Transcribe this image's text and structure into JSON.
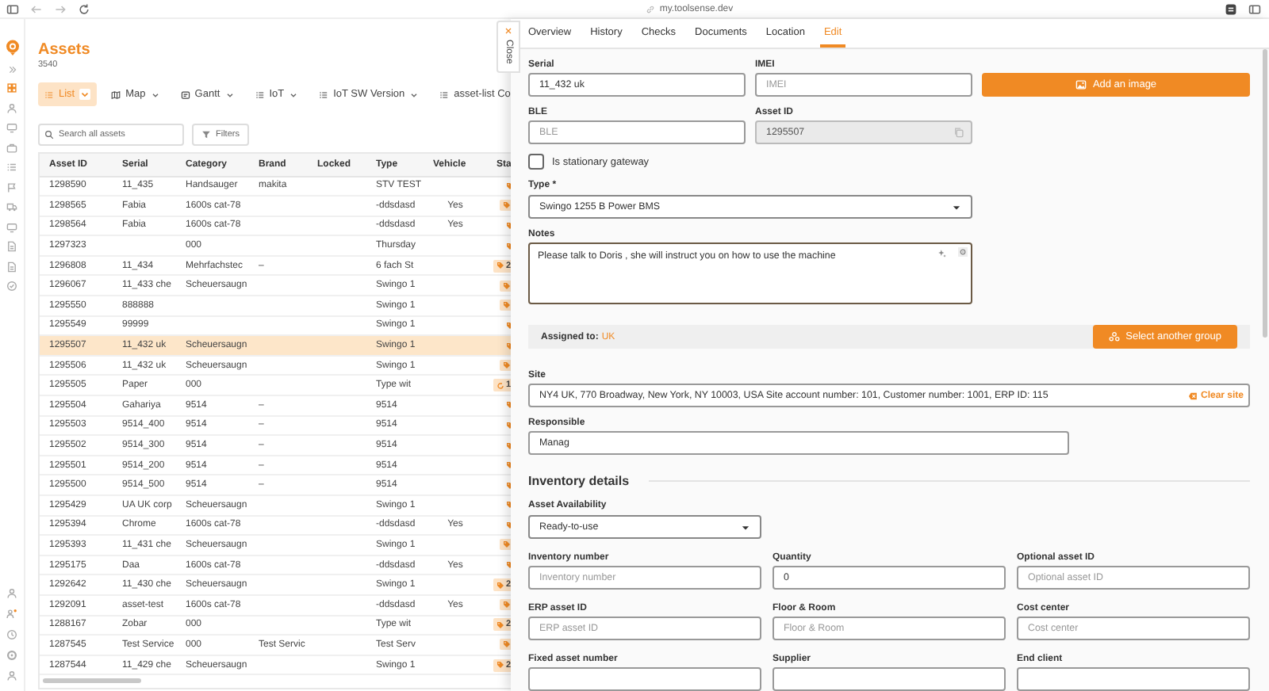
{
  "browser": {
    "url": "my.toolsense.dev"
  },
  "nav_items": [
    {
      "selected": true
    },
    {
      "selected": false
    },
    {
      "selected": false
    },
    {
      "selected": false
    },
    {
      "selected": false
    },
    {
      "selected": false
    },
    {
      "selected": false
    },
    {
      "selected": false
    },
    {
      "selected": false
    },
    {
      "selected": false
    },
    {
      "selected": false
    }
  ],
  "assets": {
    "title": "Assets",
    "count": "3540",
    "views": [
      {
        "label": "List",
        "kind": "list",
        "selected": true
      },
      {
        "label": "Map",
        "kind": "map",
        "selected": false
      },
      {
        "label": "Gantt",
        "kind": "gantt",
        "selected": false
      },
      {
        "label": "IoT",
        "kind": "list",
        "selected": false
      },
      {
        "label": "IoT SW Version",
        "kind": "list",
        "selected": false
      },
      {
        "label": "asset-list Co",
        "kind": "list",
        "selected": false
      }
    ],
    "search": {
      "placeholder": "Search all assets"
    },
    "filters_button": "Filters",
    "table": {
      "columns": [
        {
          "label": "Asset ID"
        },
        {
          "label": "Serial"
        },
        {
          "label": "Category"
        },
        {
          "label": "Brand"
        },
        {
          "label": "Locked"
        },
        {
          "label": "Type"
        },
        {
          "label": "Vehicle"
        },
        {
          "label": "Sta"
        }
      ],
      "rows": [
        {
          "asset_id": "1298590",
          "serial": "11_435",
          "category": "Handsauger",
          "brand": "makita",
          "type": "STV TEST",
          "status": {
            "kind": "plain"
          },
          "selected": false
        },
        {
          "asset_id": "1298565",
          "serial": "Fabia",
          "category": "1600s cat-78",
          "type": "-ddsdasd",
          "vehicle": "Yes",
          "status": {
            "kind": "badge"
          },
          "selected": false
        },
        {
          "asset_id": "1298564",
          "serial": "Fabia",
          "category": "1600s cat-78",
          "type": "-ddsdasd",
          "vehicle": "Yes",
          "status": {
            "kind": "plain"
          },
          "selected": false
        },
        {
          "asset_id": "1297323",
          "category": "000",
          "type": "Thursday",
          "status": {
            "kind": "plain"
          },
          "selected": false
        },
        {
          "asset_id": "1296808",
          "serial": "11_434",
          "category": "Mehrfachstec",
          "brand": "–",
          "type": "6 fach St",
          "status": {
            "kind": "count",
            "count": "2"
          },
          "selected": false
        },
        {
          "asset_id": "1296067",
          "serial": "11_433 che",
          "category": "Scheuersaugn",
          "type": "Swingo 1",
          "status": {
            "kind": "badge"
          },
          "selected": false
        },
        {
          "asset_id": "1295550",
          "serial": "888888",
          "type": "Swingo 1",
          "status": {
            "kind": "badge"
          },
          "selected": false
        },
        {
          "asset_id": "1295549",
          "serial": "99999",
          "type": "Swingo 1",
          "status": {
            "kind": "plain"
          },
          "selected": false
        },
        {
          "asset_id": "1295507",
          "serial": "11_432 uk",
          "category": "Scheuersaugn",
          "type": "Swingo 1",
          "status": {
            "kind": "plain"
          },
          "selected": true
        },
        {
          "asset_id": "1295506",
          "serial": "11_432 uk",
          "category": "Scheuersaugn",
          "type": "Swingo 1",
          "status": {
            "kind": "badge"
          },
          "selected": false
        },
        {
          "asset_id": "1295505",
          "serial": "Paper",
          "category": "000",
          "type": "Type wit",
          "status": {
            "kind": "iot",
            "count": "1"
          },
          "selected": false
        },
        {
          "asset_id": "1295504",
          "serial": "Gahariya",
          "category": "9514",
          "brand": "–",
          "type": "9514",
          "status": {
            "kind": "plain"
          },
          "selected": false
        },
        {
          "asset_id": "1295503",
          "serial": "9514_400",
          "category": "9514",
          "brand": "–",
          "type": "9514",
          "status": {
            "kind": "plain"
          },
          "selected": false
        },
        {
          "asset_id": "1295502",
          "serial": "9514_300",
          "category": "9514",
          "brand": "–",
          "type": "9514",
          "status": {
            "kind": "plain"
          },
          "selected": false
        },
        {
          "asset_id": "1295501",
          "serial": "9514_200",
          "category": "9514",
          "brand": "–",
          "type": "9514",
          "status": {
            "kind": "plain"
          },
          "selected": false
        },
        {
          "asset_id": "1295500",
          "serial": "9514_500",
          "category": "9514",
          "brand": "–",
          "type": "9514",
          "status": {
            "kind": "plain"
          },
          "selected": false
        },
        {
          "asset_id": "1295429",
          "serial": "UA UK corp",
          "category": "Scheuersaugn",
          "type": "Swingo 1",
          "status": {
            "kind": "plain"
          },
          "selected": false
        },
        {
          "asset_id": "1295394",
          "serial": "Chrome",
          "category": "1600s cat-78",
          "type": "-ddsdasd",
          "vehicle": "Yes",
          "status": {
            "kind": "plain"
          },
          "selected": false
        },
        {
          "asset_id": "1295393",
          "serial": "11_431 che",
          "category": "Scheuersaugn",
          "type": "Swingo 1",
          "status": {
            "kind": "badge"
          },
          "selected": false
        },
        {
          "asset_id": "1295175",
          "serial": "Daa",
          "category": "1600s cat-78",
          "type": "-ddsdasd",
          "vehicle": "Yes",
          "status": {
            "kind": "plain"
          },
          "selected": false
        },
        {
          "asset_id": "1292642",
          "serial": "11_430 che",
          "category": "Scheuersaugn",
          "type": "Swingo 1",
          "status": {
            "kind": "count",
            "count": "2"
          },
          "selected": false
        },
        {
          "asset_id": "1292091",
          "serial": "asset-test",
          "category": "1600s cat-78",
          "type": "-ddsdasd",
          "vehicle": "Yes",
          "status": {
            "kind": "badge"
          },
          "selected": false
        },
        {
          "asset_id": "1288167",
          "serial": "Zobar",
          "category": "000",
          "type": "Type wit",
          "status": {
            "kind": "count",
            "count": "2"
          },
          "selected": false
        },
        {
          "asset_id": "1287545",
          "serial": "Test Service",
          "category": "000",
          "brand": "Test Servic",
          "type": "Test Serv",
          "status": {
            "kind": "badge"
          },
          "selected": false
        },
        {
          "asset_id": "1287544",
          "serial": "11_429 che",
          "category": "Scheuersaugn",
          "type": "Swingo 1",
          "status": {
            "kind": "count",
            "count": "2"
          },
          "selected": false
        }
      ]
    }
  },
  "drawer": {
    "close_label": "Close",
    "tabs": [
      {
        "label": "Overview",
        "selected": false
      },
      {
        "label": "History",
        "selected": false
      },
      {
        "label": "Checks",
        "selected": false
      },
      {
        "label": "Documents",
        "selected": false
      },
      {
        "label": "Location",
        "selected": false
      },
      {
        "label": "Edit",
        "selected": true
      }
    ],
    "serial": {
      "label": "Serial",
      "value": "11_432 uk"
    },
    "imei": {
      "label": "IMEI",
      "placeholder": "IMEI"
    },
    "add_image_button": "Add an image",
    "ble": {
      "label": "BLE",
      "placeholder": "BLE"
    },
    "asset_id": {
      "label": "Asset ID",
      "value": "1295507",
      "disabled": true
    },
    "stationary_gateway": {
      "label": "Is stationary gateway",
      "checked": false
    },
    "type": {
      "label": "Type *",
      "value": "Swingo 1255 B Power BMS"
    },
    "notes": {
      "label": "Notes",
      "value": "Please talk to Doris , she will instruct you on how to use the machine"
    },
    "assigned": {
      "label": "Assigned to:",
      "group": "UK",
      "button": "Select another group"
    },
    "site": {
      "label": "Site",
      "value": "NY4 UK, 770 Broadway, New York, NY 10003, USA Site account number: 101, Customer number: 1001, ERP ID: 115",
      "clear_label": "Clear site"
    },
    "responsible": {
      "label": "Responsible",
      "value": "Manag"
    },
    "inventory": {
      "heading": "Inventory details",
      "availability": {
        "label": "Asset Availability",
        "value": "Ready-to-use"
      },
      "fields": [
        {
          "label": "Inventory number",
          "placeholder": "Inventory number"
        },
        {
          "label": "Quantity",
          "value": "0"
        },
        {
          "label": "Optional asset ID",
          "placeholder": "Optional asset ID"
        },
        {
          "label": "ERP asset ID",
          "placeholder": "ERP asset ID"
        },
        {
          "label": "Floor & Room",
          "placeholder": "Floor & Room"
        },
        {
          "label": "Cost center",
          "placeholder": "Cost center"
        },
        {
          "label": "Fixed asset number"
        },
        {
          "label": "Supplier"
        },
        {
          "label": "End client"
        }
      ]
    }
  }
}
